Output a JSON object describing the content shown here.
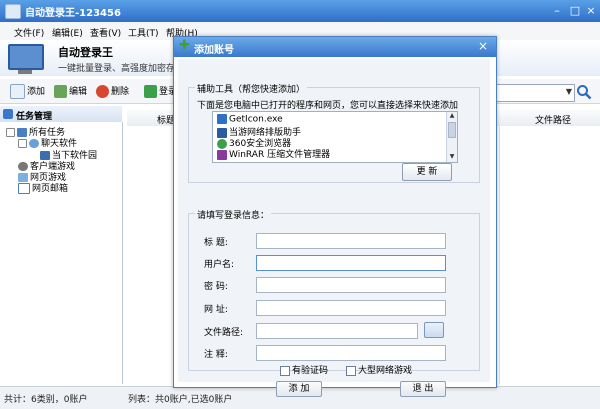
{
  "window": {
    "title": "自动登录王-123456"
  },
  "menu": [
    "文件(F)",
    "编辑(E)",
    "查看(V)",
    "工具(T)",
    "帮助(H)"
  ],
  "banner": {
    "title": "自动登录王",
    "subtitle": "一键批量登录、高强度加密存储"
  },
  "toolbar": {
    "add": "添加",
    "edit": "编辑",
    "delete": "删除",
    "login": "登录"
  },
  "left_panel": {
    "title": "任务管理",
    "tree": [
      "所有任务",
      "聊天软件",
      "当下软件园",
      "客户端游戏",
      "网页游戏",
      "网页邮箱"
    ]
  },
  "list": {
    "columns": [
      "标题",
      "文件路径"
    ]
  },
  "status": {
    "left": "共计：6类别，0账户",
    "right": "列表：共0账户,已选0账户"
  },
  "dialog": {
    "title": "添加账号",
    "helper_group": "辅助工具（帮您快速添加）",
    "helper_desc": "下面是您电脑中已打开的程序和网页，您可以直接选择来快速添加",
    "programs": [
      "GetIcon.exe",
      "当游网络排版助手",
      "360安全浏览器",
      "WinRAR 压缩文件管理器"
    ],
    "refresh": "更 新",
    "login_group": "请填写登录信息：",
    "fields": {
      "title": "标  题:",
      "username": "用户名:",
      "password": "密  码:",
      "url": "网  址:",
      "filepath": "文件路径:",
      "note": "注  释:"
    },
    "values": {
      "title": "",
      "username": "",
      "password": "",
      "url": "",
      "filepath": "",
      "note": ""
    },
    "checkbox_captcha": "有验证码",
    "checkbox_game": "大型网络游戏",
    "add_button": "添 加",
    "exit_button": "退 出"
  },
  "colors": {
    "title_bar": "#2f6fc8",
    "accent": "#3a78cc",
    "panel_bg": "#f0f3f7"
  }
}
